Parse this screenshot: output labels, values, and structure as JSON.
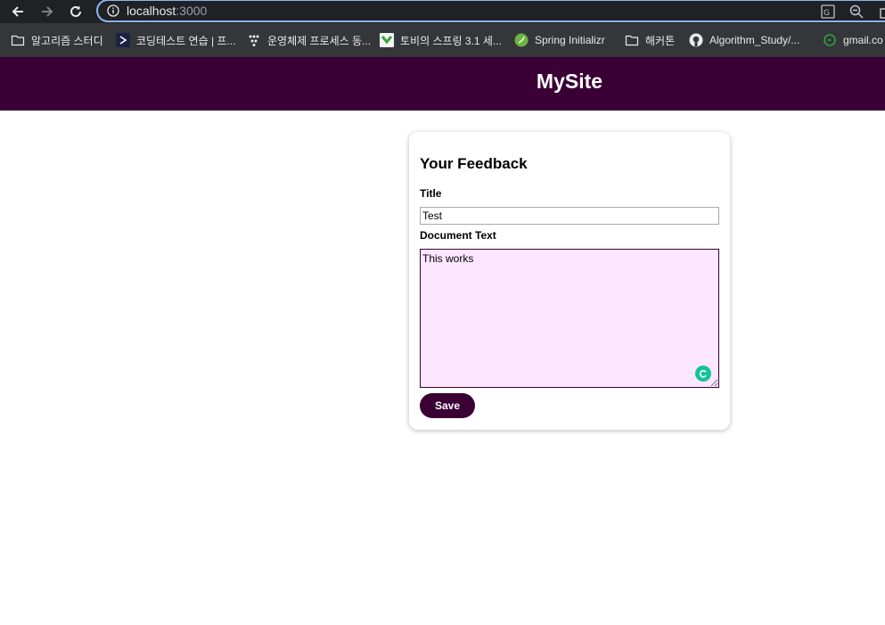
{
  "browser": {
    "url_host": "localhost",
    "url_port": ":3000",
    "bookmarks": [
      {
        "label": "알고리즘 스터디",
        "icon": "folder-icon"
      },
      {
        "label": "코딩테스트 연습 | 프...",
        "icon": "programmers-icon"
      },
      {
        "label": "운영체제 프로세스 동...",
        "icon": "dots-icon"
      },
      {
        "label": "토비의 스프링 3.1 세...",
        "icon": "green-bookmark-icon"
      },
      {
        "label": "Spring Initializr",
        "icon": "spring-icon"
      },
      {
        "label": "해커톤",
        "icon": "folder-icon"
      },
      {
        "label": "Algorithm_Study/...",
        "icon": "github-icon"
      },
      {
        "label": "gmail.co",
        "icon": "gmail-icon"
      }
    ]
  },
  "header": {
    "title": "MySite"
  },
  "form": {
    "heading": "Your Feedback",
    "title_label": "Title",
    "title_value": "Test",
    "text_label": "Document Text",
    "text_value": "This works",
    "save_label": "Save"
  },
  "colors": {
    "brand": "#3a0035",
    "textarea_bg": "#fde6ff",
    "grammarly": "#15c39a"
  }
}
